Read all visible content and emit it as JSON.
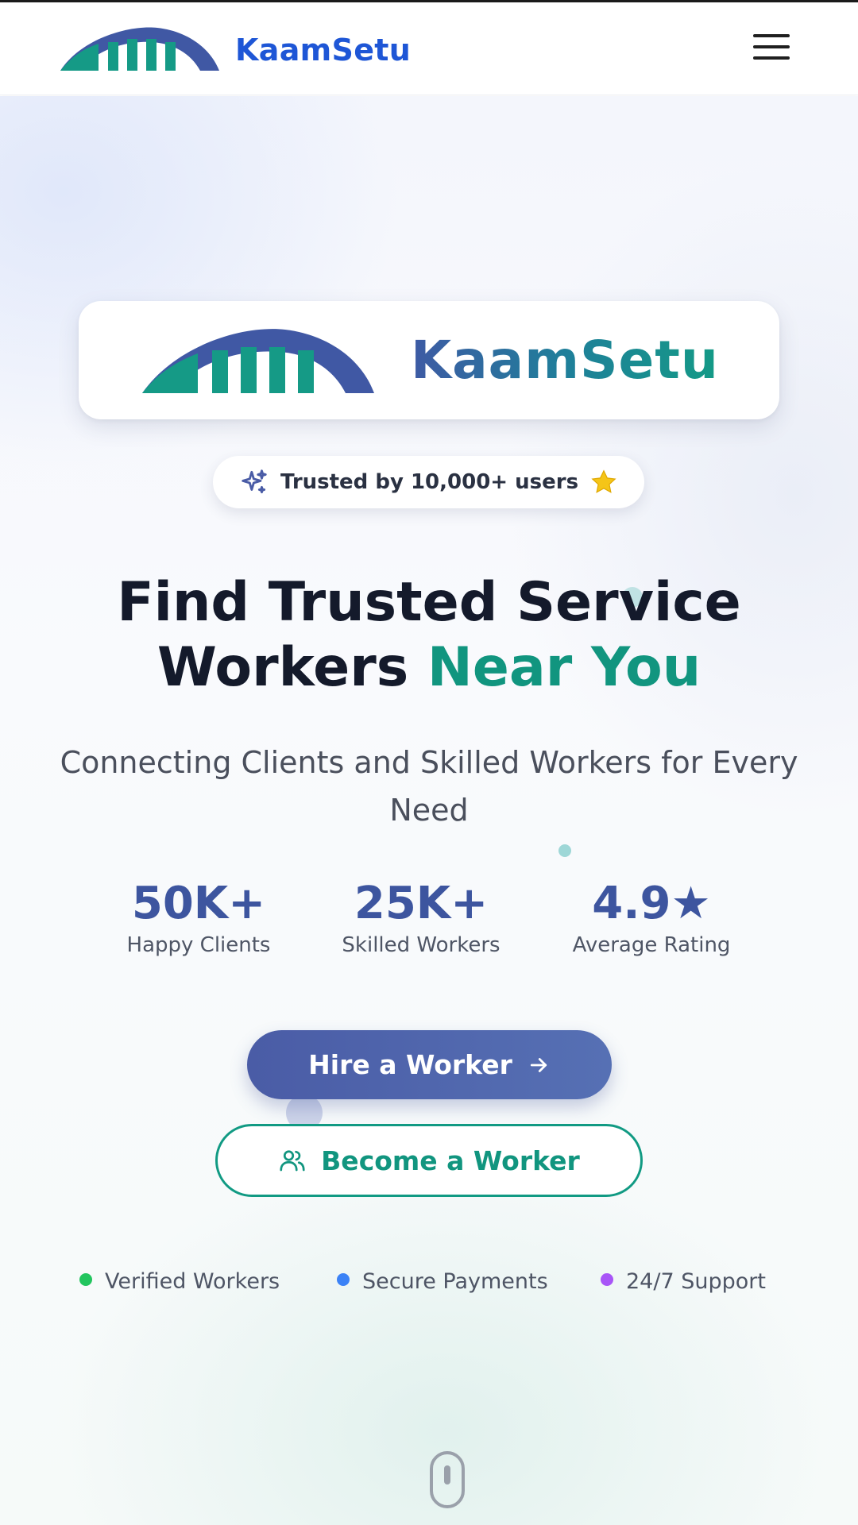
{
  "header": {
    "brand": "KaamSetu",
    "menu_icon": "hamburger-menu-icon"
  },
  "hero": {
    "logo_card": {
      "brand": "KaamSetu"
    },
    "trust_badge": {
      "text": "Trusted by 10,000+ users",
      "left_icon": "sparkles-icon",
      "right_icon": "star-icon"
    },
    "headline": {
      "line1": "Find Trusted Service",
      "line2_plain": "Workers ",
      "line2_accent": "Near You"
    },
    "subtitle": "Connecting Clients and Skilled Workers for Every Need",
    "stats": [
      {
        "value": "50K+",
        "label": "Happy Clients"
      },
      {
        "value": "25K+",
        "label": "Skilled Workers"
      },
      {
        "value": "4.9★",
        "label": "Average Rating"
      }
    ],
    "primary_cta": {
      "label": "Hire a Worker",
      "icon": "arrow-right-icon"
    },
    "secondary_cta": {
      "label": "Become a Worker",
      "icon": "users-icon"
    },
    "features": [
      {
        "label": "Verified Workers",
        "color": "#22c55e"
      },
      {
        "label": "Secure Payments",
        "color": "#3b82f6"
      },
      {
        "label": "24/7 Support",
        "color": "#a855f7"
      }
    ],
    "scroll_icon": "mouse-scroll-icon"
  },
  "colors": {
    "brand_blue": "#1e56d6",
    "primary_indigo": "#4a5ca6",
    "accent_teal": "#11957f",
    "text_dark": "#141a2b"
  }
}
